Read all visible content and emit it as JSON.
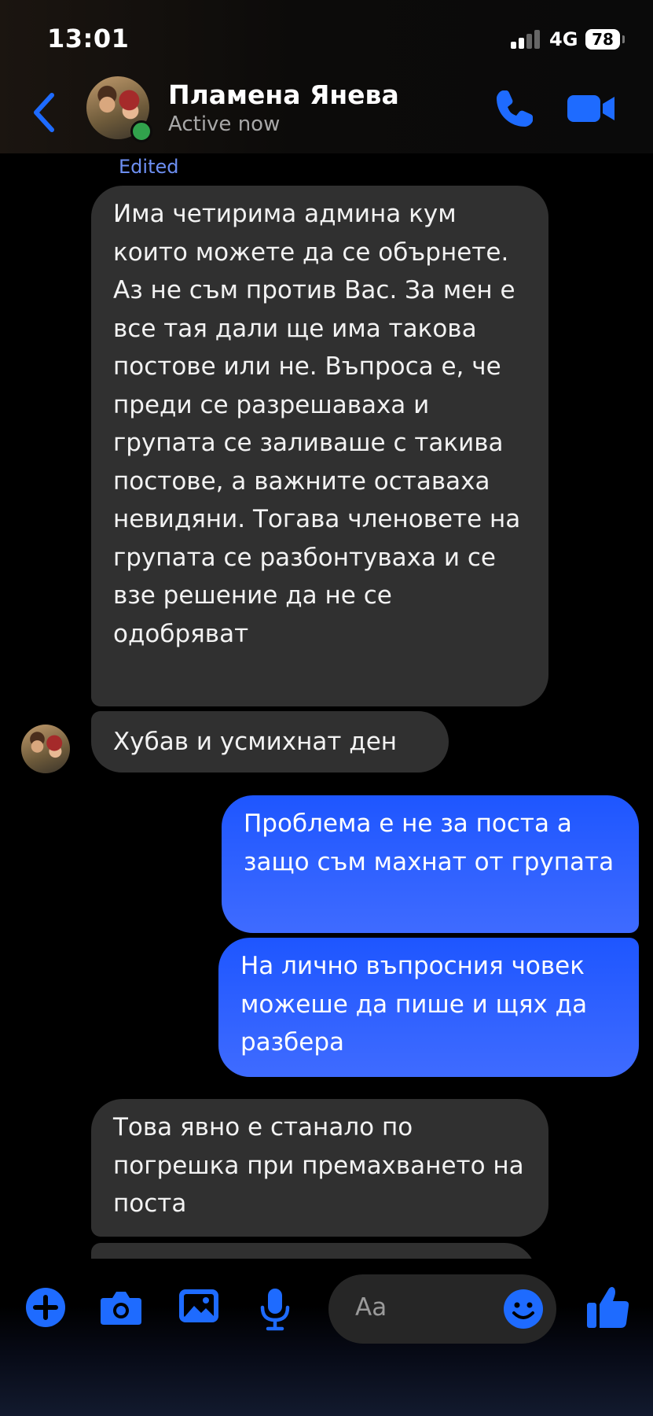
{
  "status_bar": {
    "time": "13:01",
    "network": "4G",
    "battery": "78"
  },
  "header": {
    "contact_name": "Пламена Янева",
    "status": "Active now"
  },
  "messages": [
    {
      "label": "Edited"
    },
    {
      "text": "Има четирима админа кум които можете да се обърнете. Аз не съм против Вас. За мен е все тая дали ще има такова постове или не. Въпроса е, че преди се разрешаваха и групата се заливаше с такива постове, а важните оставаха невидяни. Тогава членовете на групата се разбонтуваха и се взе решение да не се одобряват"
    },
    {
      "text": "Хубав и усмихнат ден"
    },
    {
      "text": "Проблема е не за поста а защо съм махнат от групата"
    },
    {
      "text": "На лично въпросния човек можеше да пише и щях да разбера"
    },
    {
      "text": "Това явно е станало по погрешка при премахването на поста"
    }
  ],
  "composer": {
    "placeholder": "Aa"
  },
  "colors": {
    "accent": "#1e6bff",
    "incoming_bubble": "#303030",
    "outgoing_bubble": "#2f5fff",
    "active": "#31a24c"
  }
}
